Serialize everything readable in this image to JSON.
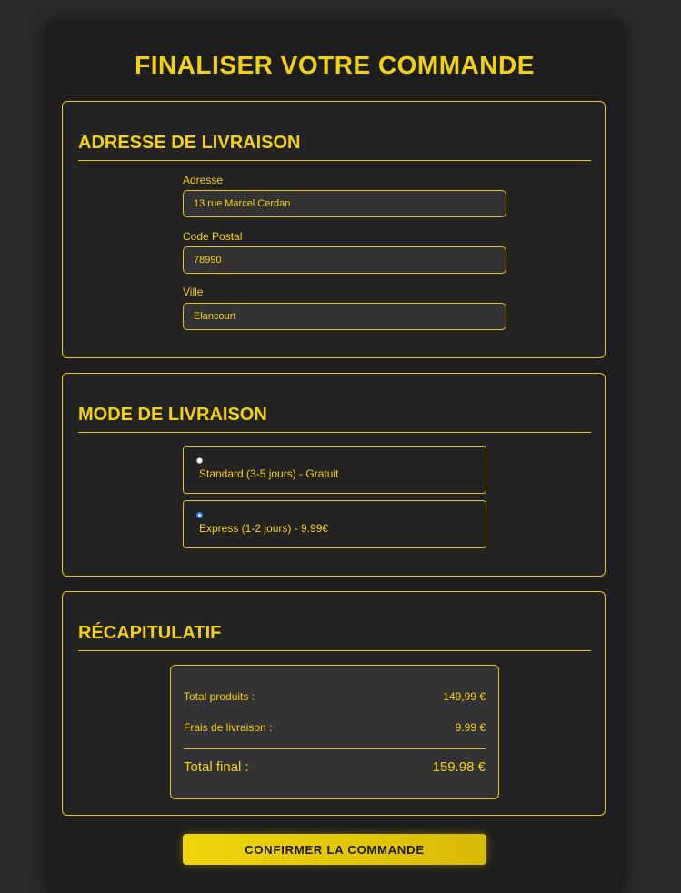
{
  "page": {
    "title": "FINALISER VOTRE COMMANDE"
  },
  "address": {
    "title": "ADRESSE DE LIVRAISON",
    "fields": [
      {
        "label": "Adresse",
        "value": "13 rue Marcel Cerdan"
      },
      {
        "label": "Code Postal",
        "value": "78990"
      },
      {
        "label": "Ville",
        "value": "Elancourt"
      }
    ]
  },
  "shipping": {
    "title": "MODE DE LIVRAISON",
    "options": [
      {
        "label": "Standard (3-5 jours) - Gratuit",
        "selected": false
      },
      {
        "label": "Express (1-2 jours) - 9.99€",
        "selected": true
      }
    ]
  },
  "summary": {
    "title": "RÉCAPITULATIF",
    "products_label": "Total produits :",
    "products_value": "149,99 €",
    "shipping_label": "Frais de livraison :",
    "shipping_value": "9.99 €",
    "total_label": "Total final :",
    "total_value": "159.98 €"
  },
  "actions": {
    "confirm_label": "CONFIRMER LA COMMANDE"
  },
  "colors": {
    "accent": "#f2d20f",
    "background": "#2a2a2a",
    "panel": "#1e1e1e",
    "input_bg": "#333333"
  }
}
